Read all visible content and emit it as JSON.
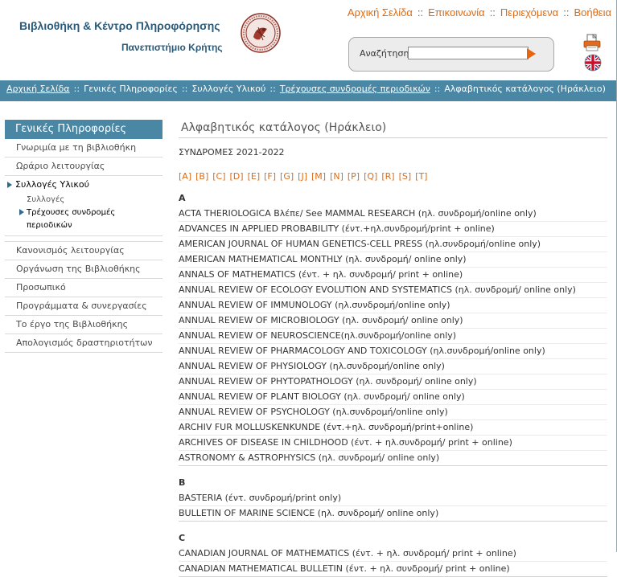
{
  "header": {
    "library_title": "Βιβλιοθήκη & Κέντρο Πληροφόρησης",
    "university": "Πανεπιστήμιο Κρήτης",
    "top_nav": [
      "Αρχική Σελίδα",
      "Επικοινωνία",
      "Περιεχόμενα",
      "Βοήθεια"
    ],
    "search_label": "Αναζήτηση",
    "search_value": "",
    "icons": [
      "university-seal",
      "print-icon",
      "english-flag-icon"
    ]
  },
  "breadcrumb": [
    {
      "label": "Αρχική Σελίδα",
      "link": true
    },
    {
      "label": "Γενικές Πληροφορίες",
      "link": false
    },
    {
      "label": "Συλλογές Υλικού",
      "link": false
    },
    {
      "label": "Τρέχουσες συνδρομές περιοδικών",
      "link": true
    },
    {
      "label": "Αλφαβητικός κατάλογος (Ηράκλειο)",
      "link": false
    }
  ],
  "breadcrumb_separator": "::",
  "sidebar": {
    "heading": "Γενικές Πληροφορίες",
    "items_top": [
      "Γνωριμία με τη βιβλιοθήκη",
      "Ωράριο λειτουργίας"
    ],
    "active_item": "Συλλογές Υλικού",
    "sub_items": [
      "Συλλογές"
    ],
    "current_sub_item": "Τρέχουσες συνδρομές περιοδικών",
    "items_bottom": [
      "Κανονισμός λειτουργίας",
      "Οργάνωση της Βιβλιοθήκης",
      "Προσωπικό",
      "Προγράμματα & συνεργασίες",
      "Το έργο της Βιβλιοθήκης",
      "Απολογισμός δραστηριοτήτων"
    ]
  },
  "main": {
    "title": "Αλφαβητικός κατάλογος (Ηράκλειο)",
    "subscriptions": "ΣΥΝΔΡΟΜΕΣ 2021-2022",
    "letters": [
      "[A]",
      "[B]",
      "[C]",
      "[D]",
      "[E]",
      "[F]",
      "[G]",
      "[J]",
      "[M]",
      "[N]",
      "[P]",
      "[Q]",
      "[R]",
      "[S]",
      "[T]"
    ],
    "sections": [
      {
        "letter": "A",
        "entries": [
          "ACTA THERIOLOGICA Βλέπε/ See MAMMAL RESEARCH (ηλ. συνδρομή/online only)",
          "ADVANCES IN APPLIED PROBABILITY (έντ.+ηλ.συνδρομή/print + online)",
          "AMERICAN JOURNAL OF HUMAN GENETICS-CELL PRESS (ηλ.συνδρομή/online only)",
          "AMERICAN MATHEMATICAL MONTHLY (ηλ. συνδρομή/ online only)",
          "ANNALS OF MATHEMATICS (έντ. + ηλ. συνδρομή/ print + online)",
          "ANNUAL REVIEW OF ECOLOGY EVOLUTION AND SYSTEMATICS (ηλ. συνδρομή/ online only)",
          "ANNUAL REVIEW OF IMMUNOLOGY (ηλ.συνδρομή/online only)",
          "ANNUAL REVIEW OF MICROBIOLOGY (ηλ. συνδρομή/ online only)",
          "ANNUAL REVIEW OF NEUROSCIENCE(ηλ.συνδρομή/online only)",
          "ANNUAL REVIEW OF PHARMACOLOGY AND TOXICOLOGY (ηλ.συνδρομή/online only)",
          "ANNUAL REVIEW OF PHYSIOLOGY (ηλ.συνδρομή/online only)",
          "ANNUAL REVIEW OF PHYTOPATHOLOGY (ηλ. συνδρομή/ online only)",
          "ANNUAL REVIEW OF PLANT BIOLOGY (ηλ. συνδρομή/ online only)",
          "ANNUAL REVIEW OF PSYCHOLOGY (ηλ.συνδρομή/online only)",
          "ARCHIV FUR MOLLUSKENKUNDE (έντ.+ηλ. συνδρομή/print+online)",
          "ARCHIVES OF DISEASE IN CHILDHOOD (έντ. + ηλ.συνδρομή/ print + online)",
          "ASTRONOMY & ASTROPHYSICS (ηλ. συνδρομή/ online only)"
        ]
      },
      {
        "letter": "B",
        "entries": [
          "BASTERIA (έντ. συνδρομή/print only)",
          "BULLETIN OF MARINE SCIENCE (ηλ. συνδρομή/ online only)"
        ]
      },
      {
        "letter": "C",
        "entries": [
          "CANADIAN JOURNAL OF MATHEMATICS (έντ. + ηλ. συνδρομή/ print + online)",
          "CANADIAN MATHEMATICAL BULLETIN (έντ. + ηλ. συνδρομή/ print + online)"
        ]
      }
    ]
  },
  "colors": {
    "brand_blue": "#4a87a5",
    "title_blue": "#2b5a79",
    "link_orange": "#e06a10"
  }
}
